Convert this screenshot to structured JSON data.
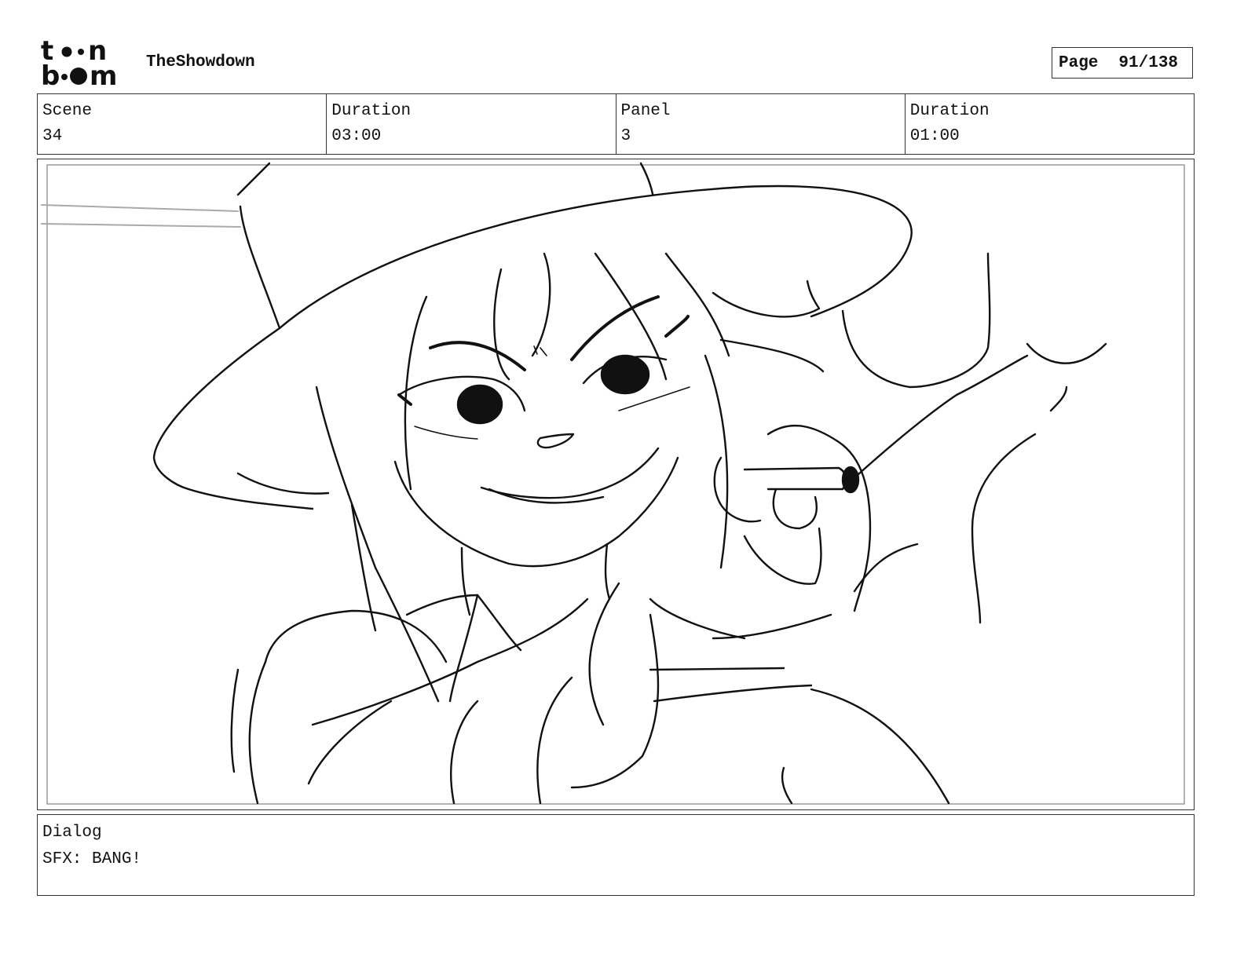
{
  "header": {
    "logo_line1": "toon",
    "logo_line2": "boom",
    "project_title": "TheShowdown",
    "page_label": "Page",
    "page_number": "91/138"
  },
  "info": [
    {
      "label": "Scene",
      "value": "34"
    },
    {
      "label": "Duration",
      "value": "03:00"
    },
    {
      "label": "Panel",
      "value": "3"
    },
    {
      "label": "Duration",
      "value": "01:00"
    }
  ],
  "dialog": {
    "label": "Dialog",
    "text": "SFX: BANG!"
  }
}
